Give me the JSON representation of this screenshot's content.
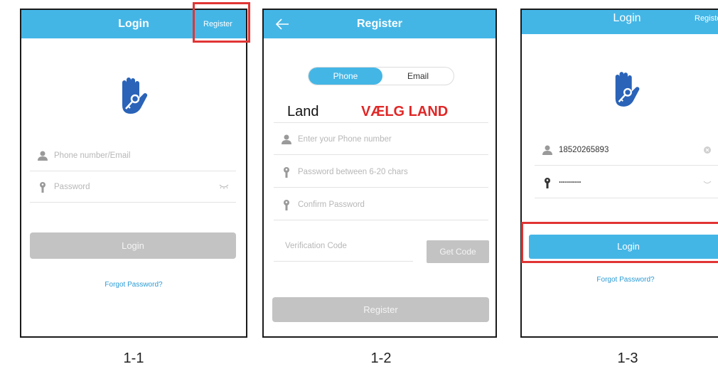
{
  "screen1": {
    "title": "Login",
    "register_link": "Register",
    "phone_placeholder": "Phone number/Email",
    "password_placeholder": "Password",
    "login_button": "Login",
    "forgot_link": "Forgot Password?",
    "caption": "1-1"
  },
  "screen2": {
    "title": "Register",
    "tab_phone": "Phone",
    "tab_email": "Email",
    "land_label": "Land",
    "land_select": "VÆLG LAND",
    "phone_placeholder": "Enter your Phone number",
    "password_placeholder": "Password between 6-20 chars",
    "confirm_placeholder": "Confirm Password",
    "code_placeholder": "Verification Code",
    "get_code_button": "Get Code",
    "register_button": "Register",
    "caption": "1-2"
  },
  "screen3": {
    "title": "Login",
    "register_link": "Registe",
    "phone_value": "18520265893",
    "password_value": "···········",
    "login_button": "Login",
    "forgot_link": "Forgot Password?",
    "caption": "1-3"
  },
  "colors": {
    "accent": "#44b6e6",
    "highlight": "#e13434",
    "disabled_button": "#c3c3c3",
    "link": "#2b9bd5",
    "logo": "#2a63b8"
  },
  "icons": [
    "hand-key-logo",
    "user-icon",
    "key-icon",
    "eye-closed-icon",
    "clear-icon",
    "back-arrow-icon"
  ]
}
